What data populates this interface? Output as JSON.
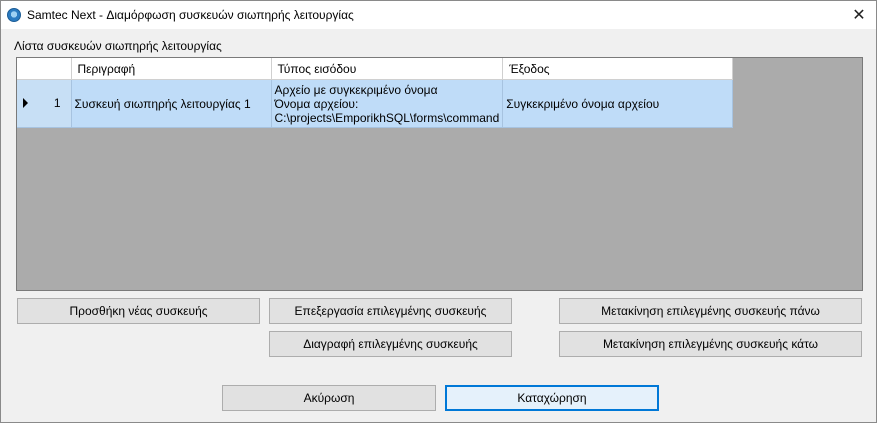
{
  "window": {
    "title": "Samtec Next - Διαμόρφωση συσκευών σιωπηρής λειτουργίας",
    "close_glyph": "✕"
  },
  "list_label": "Λίστα συσκευών σιωπηρής λειτουργίας",
  "table": {
    "columns": [
      "Περιγραφή",
      "Τύπος εισόδου",
      "Έξοδος"
    ],
    "rows": [
      {
        "number": "1",
        "description": "Συσκευή σιωπηρής λειτουργίας 1",
        "input_type_lines": [
          "Αρχείο με συγκεκριμένο όνομα",
          "Όνομα αρχείου:",
          "C:\\projects\\EmporikhSQL\\forms\\command"
        ],
        "output": "Συγκεκριμένο όνομα αρχείου"
      }
    ]
  },
  "buttons": {
    "add": "Προσθήκη νέας συσκευής",
    "edit": "Επεξεργασία επιλεγμένης συσκευής",
    "delete": "Διαγραφή επιλεγμένης συσκευής",
    "move_up": "Μετακίνηση επιλεγμένης συσκευής πάνω",
    "move_down": "Μετακίνηση επιλεγμένης συσκευής κάτω",
    "cancel": "Ακύρωση",
    "submit": "Καταχώρηση"
  },
  "icons": {
    "app": "app-icon",
    "close": "close-icon",
    "row_indicator": "row-selector-arrow-icon"
  },
  "colors": {
    "selection": "#bfdcf8",
    "grid_background": "#ababab",
    "default_button_border": "#0078d7"
  }
}
